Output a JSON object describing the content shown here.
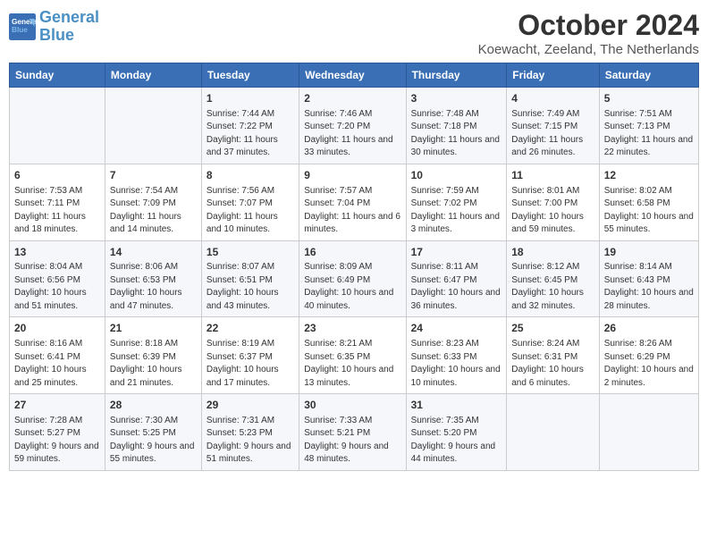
{
  "header": {
    "logo_line1": "General",
    "logo_line2": "Blue",
    "month": "October 2024",
    "location": "Koewacht, Zeeland, The Netherlands"
  },
  "days_of_week": [
    "Sunday",
    "Monday",
    "Tuesday",
    "Wednesday",
    "Thursday",
    "Friday",
    "Saturday"
  ],
  "weeks": [
    [
      {
        "day": "",
        "sunrise": "",
        "sunset": "",
        "daylight": ""
      },
      {
        "day": "",
        "sunrise": "",
        "sunset": "",
        "daylight": ""
      },
      {
        "day": "1",
        "sunrise": "Sunrise: 7:44 AM",
        "sunset": "Sunset: 7:22 PM",
        "daylight": "Daylight: 11 hours and 37 minutes."
      },
      {
        "day": "2",
        "sunrise": "Sunrise: 7:46 AM",
        "sunset": "Sunset: 7:20 PM",
        "daylight": "Daylight: 11 hours and 33 minutes."
      },
      {
        "day": "3",
        "sunrise": "Sunrise: 7:48 AM",
        "sunset": "Sunset: 7:18 PM",
        "daylight": "Daylight: 11 hours and 30 minutes."
      },
      {
        "day": "4",
        "sunrise": "Sunrise: 7:49 AM",
        "sunset": "Sunset: 7:15 PM",
        "daylight": "Daylight: 11 hours and 26 minutes."
      },
      {
        "day": "5",
        "sunrise": "Sunrise: 7:51 AM",
        "sunset": "Sunset: 7:13 PM",
        "daylight": "Daylight: 11 hours and 22 minutes."
      }
    ],
    [
      {
        "day": "6",
        "sunrise": "Sunrise: 7:53 AM",
        "sunset": "Sunset: 7:11 PM",
        "daylight": "Daylight: 11 hours and 18 minutes."
      },
      {
        "day": "7",
        "sunrise": "Sunrise: 7:54 AM",
        "sunset": "Sunset: 7:09 PM",
        "daylight": "Daylight: 11 hours and 14 minutes."
      },
      {
        "day": "8",
        "sunrise": "Sunrise: 7:56 AM",
        "sunset": "Sunset: 7:07 PM",
        "daylight": "Daylight: 11 hours and 10 minutes."
      },
      {
        "day": "9",
        "sunrise": "Sunrise: 7:57 AM",
        "sunset": "Sunset: 7:04 PM",
        "daylight": "Daylight: 11 hours and 6 minutes."
      },
      {
        "day": "10",
        "sunrise": "Sunrise: 7:59 AM",
        "sunset": "Sunset: 7:02 PM",
        "daylight": "Daylight: 11 hours and 3 minutes."
      },
      {
        "day": "11",
        "sunrise": "Sunrise: 8:01 AM",
        "sunset": "Sunset: 7:00 PM",
        "daylight": "Daylight: 10 hours and 59 minutes."
      },
      {
        "day": "12",
        "sunrise": "Sunrise: 8:02 AM",
        "sunset": "Sunset: 6:58 PM",
        "daylight": "Daylight: 10 hours and 55 minutes."
      }
    ],
    [
      {
        "day": "13",
        "sunrise": "Sunrise: 8:04 AM",
        "sunset": "Sunset: 6:56 PM",
        "daylight": "Daylight: 10 hours and 51 minutes."
      },
      {
        "day": "14",
        "sunrise": "Sunrise: 8:06 AM",
        "sunset": "Sunset: 6:53 PM",
        "daylight": "Daylight: 10 hours and 47 minutes."
      },
      {
        "day": "15",
        "sunrise": "Sunrise: 8:07 AM",
        "sunset": "Sunset: 6:51 PM",
        "daylight": "Daylight: 10 hours and 43 minutes."
      },
      {
        "day": "16",
        "sunrise": "Sunrise: 8:09 AM",
        "sunset": "Sunset: 6:49 PM",
        "daylight": "Daylight: 10 hours and 40 minutes."
      },
      {
        "day": "17",
        "sunrise": "Sunrise: 8:11 AM",
        "sunset": "Sunset: 6:47 PM",
        "daylight": "Daylight: 10 hours and 36 minutes."
      },
      {
        "day": "18",
        "sunrise": "Sunrise: 8:12 AM",
        "sunset": "Sunset: 6:45 PM",
        "daylight": "Daylight: 10 hours and 32 minutes."
      },
      {
        "day": "19",
        "sunrise": "Sunrise: 8:14 AM",
        "sunset": "Sunset: 6:43 PM",
        "daylight": "Daylight: 10 hours and 28 minutes."
      }
    ],
    [
      {
        "day": "20",
        "sunrise": "Sunrise: 8:16 AM",
        "sunset": "Sunset: 6:41 PM",
        "daylight": "Daylight: 10 hours and 25 minutes."
      },
      {
        "day": "21",
        "sunrise": "Sunrise: 8:18 AM",
        "sunset": "Sunset: 6:39 PM",
        "daylight": "Daylight: 10 hours and 21 minutes."
      },
      {
        "day": "22",
        "sunrise": "Sunrise: 8:19 AM",
        "sunset": "Sunset: 6:37 PM",
        "daylight": "Daylight: 10 hours and 17 minutes."
      },
      {
        "day": "23",
        "sunrise": "Sunrise: 8:21 AM",
        "sunset": "Sunset: 6:35 PM",
        "daylight": "Daylight: 10 hours and 13 minutes."
      },
      {
        "day": "24",
        "sunrise": "Sunrise: 8:23 AM",
        "sunset": "Sunset: 6:33 PM",
        "daylight": "Daylight: 10 hours and 10 minutes."
      },
      {
        "day": "25",
        "sunrise": "Sunrise: 8:24 AM",
        "sunset": "Sunset: 6:31 PM",
        "daylight": "Daylight: 10 hours and 6 minutes."
      },
      {
        "day": "26",
        "sunrise": "Sunrise: 8:26 AM",
        "sunset": "Sunset: 6:29 PM",
        "daylight": "Daylight: 10 hours and 2 minutes."
      }
    ],
    [
      {
        "day": "27",
        "sunrise": "Sunrise: 7:28 AM",
        "sunset": "Sunset: 5:27 PM",
        "daylight": "Daylight: 9 hours and 59 minutes."
      },
      {
        "day": "28",
        "sunrise": "Sunrise: 7:30 AM",
        "sunset": "Sunset: 5:25 PM",
        "daylight": "Daylight: 9 hours and 55 minutes."
      },
      {
        "day": "29",
        "sunrise": "Sunrise: 7:31 AM",
        "sunset": "Sunset: 5:23 PM",
        "daylight": "Daylight: 9 hours and 51 minutes."
      },
      {
        "day": "30",
        "sunrise": "Sunrise: 7:33 AM",
        "sunset": "Sunset: 5:21 PM",
        "daylight": "Daylight: 9 hours and 48 minutes."
      },
      {
        "day": "31",
        "sunrise": "Sunrise: 7:35 AM",
        "sunset": "Sunset: 5:20 PM",
        "daylight": "Daylight: 9 hours and 44 minutes."
      },
      {
        "day": "",
        "sunrise": "",
        "sunset": "",
        "daylight": ""
      },
      {
        "day": "",
        "sunrise": "",
        "sunset": "",
        "daylight": ""
      }
    ]
  ]
}
